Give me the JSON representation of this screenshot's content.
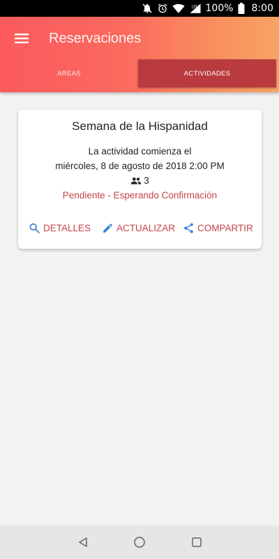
{
  "status_bar": {
    "network": "LTE",
    "battery": "100%",
    "time": "8:00"
  },
  "app_bar": {
    "title": "Reservaciones",
    "menu_icon": "menu-icon"
  },
  "tabs": [
    {
      "label": "AREAS",
      "active": false
    },
    {
      "label": "ACTIVIDADES",
      "active": true
    }
  ],
  "card": {
    "title": "Semana de la Hispanidad",
    "line1": "La actividad comienza el",
    "line2": "miércoles, 8 de agosto de 2018 2:00 PM",
    "participants": "3",
    "status": "Pendiente - Esperando Confirmación",
    "actions": {
      "details": "DETALLES",
      "update": "ACTUALIZAR",
      "share": "COMPARTIR"
    }
  },
  "colors": {
    "gradient_start": "#fb5a5d",
    "gradient_end": "#f8a365",
    "active_tab": "#b93a3f",
    "action_text": "#c4444a",
    "action_icon": "#3a86d8",
    "status_text": "#c4444a"
  }
}
